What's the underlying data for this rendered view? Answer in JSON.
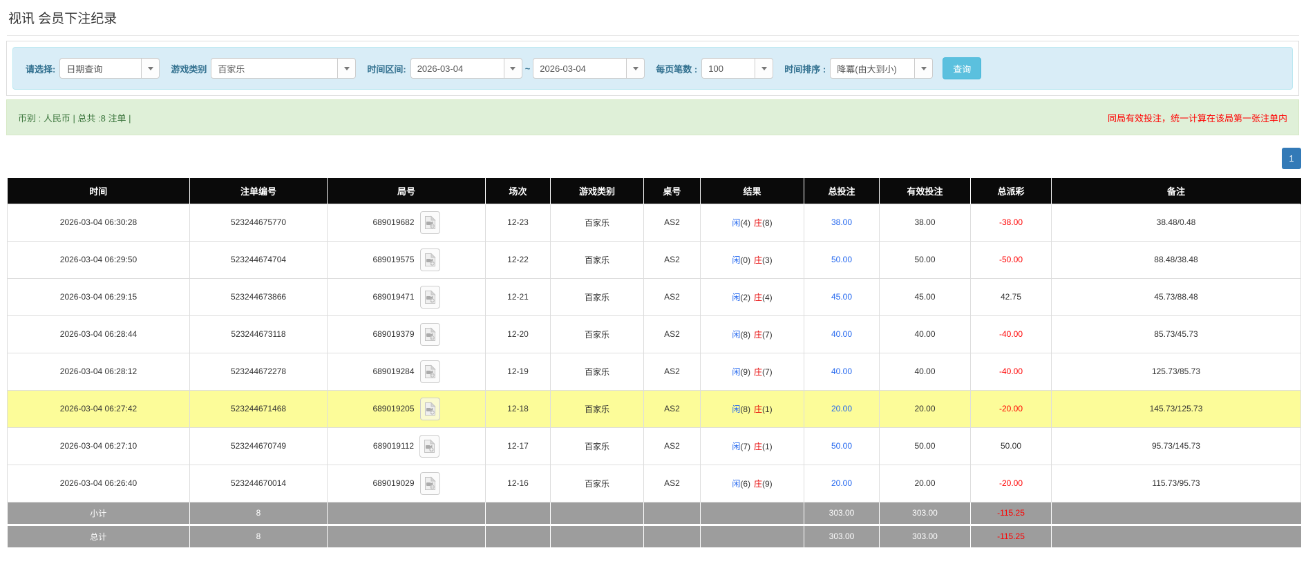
{
  "page": {
    "title": "视讯 会员下注纪录"
  },
  "filters": {
    "query_type_label": "请选择:",
    "query_type_value": "日期查询",
    "game_type_label": "游戏类别",
    "game_type_value": "百家乐",
    "date_range_label": "时间区间:",
    "date_from": "2026-03-04",
    "range_separator": "~",
    "date_to": "2026-03-04",
    "page_size_label": "每页笔数 :",
    "page_size_value": "100",
    "sort_label": "时间排序 :",
    "sort_value": "降冪(由大到小)",
    "search_button": "查询"
  },
  "notice": {
    "left": "币别 : 人民币 | 总共 :8 注单 |",
    "right": "同局有效投注，统一计算在该局第一张注单内"
  },
  "pagination": {
    "current_page": "1"
  },
  "table": {
    "headers": [
      "时间",
      "注单编号",
      "局号",
      "场次",
      "游戏类别",
      "桌号",
      "结果",
      "总投注",
      "有效投注",
      "总派彩",
      "备注"
    ],
    "rows": [
      {
        "time": "2026-03-04 06:30:28",
        "bet_id": "523244675770",
        "round_id": "689019682",
        "session": "12-23",
        "game_type": "百家乐",
        "table_id": "AS2",
        "result": {
          "player": "闲(4)",
          "banker": "庄(8)"
        },
        "total_bet": "38.00",
        "valid_bet": "38.00",
        "payout": "-38.00",
        "remark": "38.48/0.48",
        "highlighted": false
      },
      {
        "time": "2026-03-04 06:29:50",
        "bet_id": "523244674704",
        "round_id": "689019575",
        "session": "12-22",
        "game_type": "百家乐",
        "table_id": "AS2",
        "result": {
          "player": "闲(0)",
          "banker": "庄(3)"
        },
        "total_bet": "50.00",
        "valid_bet": "50.00",
        "payout": "-50.00",
        "remark": "88.48/38.48",
        "highlighted": false
      },
      {
        "time": "2026-03-04 06:29:15",
        "bet_id": "523244673866",
        "round_id": "689019471",
        "session": "12-21",
        "game_type": "百家乐",
        "table_id": "AS2",
        "result": {
          "player": "闲(2)",
          "banker": "庄(4)"
        },
        "total_bet": "45.00",
        "valid_bet": "45.00",
        "payout": "42.75",
        "remark": "45.73/88.48",
        "highlighted": false
      },
      {
        "time": "2026-03-04 06:28:44",
        "bet_id": "523244673118",
        "round_id": "689019379",
        "session": "12-20",
        "game_type": "百家乐",
        "table_id": "AS2",
        "result": {
          "player": "闲(8)",
          "banker": "庄(7)"
        },
        "total_bet": "40.00",
        "valid_bet": "40.00",
        "payout": "-40.00",
        "remark": "85.73/45.73",
        "highlighted": false
      },
      {
        "time": "2026-03-04 06:28:12",
        "bet_id": "523244672278",
        "round_id": "689019284",
        "session": "12-19",
        "game_type": "百家乐",
        "table_id": "AS2",
        "result": {
          "player": "闲(9)",
          "banker": "庄(7)"
        },
        "total_bet": "40.00",
        "valid_bet": "40.00",
        "payout": "-40.00",
        "remark": "125.73/85.73",
        "highlighted": false
      },
      {
        "time": "2026-03-04 06:27:42",
        "bet_id": "523244671468",
        "round_id": "689019205",
        "session": "12-18",
        "game_type": "百家乐",
        "table_id": "AS2",
        "result": {
          "player": "闲(8)",
          "banker": "庄(1)"
        },
        "total_bet": "20.00",
        "valid_bet": "20.00",
        "payout": "-20.00",
        "remark": "145.73/125.73",
        "highlighted": true
      },
      {
        "time": "2026-03-04 06:27:10",
        "bet_id": "523244670749",
        "round_id": "689019112",
        "session": "12-17",
        "game_type": "百家乐",
        "table_id": "AS2",
        "result": {
          "player": "闲(7)",
          "banker": "庄(1)"
        },
        "total_bet": "50.00",
        "valid_bet": "50.00",
        "payout": "50.00",
        "remark": "95.73/145.73",
        "highlighted": false
      },
      {
        "time": "2026-03-04 06:26:40",
        "bet_id": "523244670014",
        "round_id": "689019029",
        "session": "12-16",
        "game_type": "百家乐",
        "table_id": "AS2",
        "result": {
          "player": "闲(6)",
          "banker": "庄(9)"
        },
        "total_bet": "20.00",
        "valid_bet": "20.00",
        "payout": "-20.00",
        "remark": "115.73/95.73",
        "highlighted": false
      }
    ],
    "subtotal": {
      "label": "小计",
      "count": "8",
      "total_bet": "303.00",
      "valid_bet": "303.00",
      "payout": "-115.25"
    },
    "total": {
      "label": "总计",
      "count": "8",
      "total_bet": "303.00",
      "valid_bet": "303.00",
      "payout": "-115.25"
    }
  },
  "icons": {
    "dropdown": "caret-down-icon",
    "round_video": "video-record-icon"
  },
  "colors": {
    "filter_bg": "#d9edf7",
    "filter_border": "#bce8f1",
    "filter_label": "#31708f",
    "search_button": "#5bc0de",
    "notice_bg": "#dff0d8",
    "notice_text": "#3c763d",
    "alert_red": "#ff0000",
    "link_blue": "#2266ee",
    "banker_red": "#e60000",
    "header_bg": "#0a0a0a",
    "highlight_yellow": "#fcfc99",
    "summary_gray": "#9d9d9d",
    "pagination_blue": "#337ab7"
  }
}
